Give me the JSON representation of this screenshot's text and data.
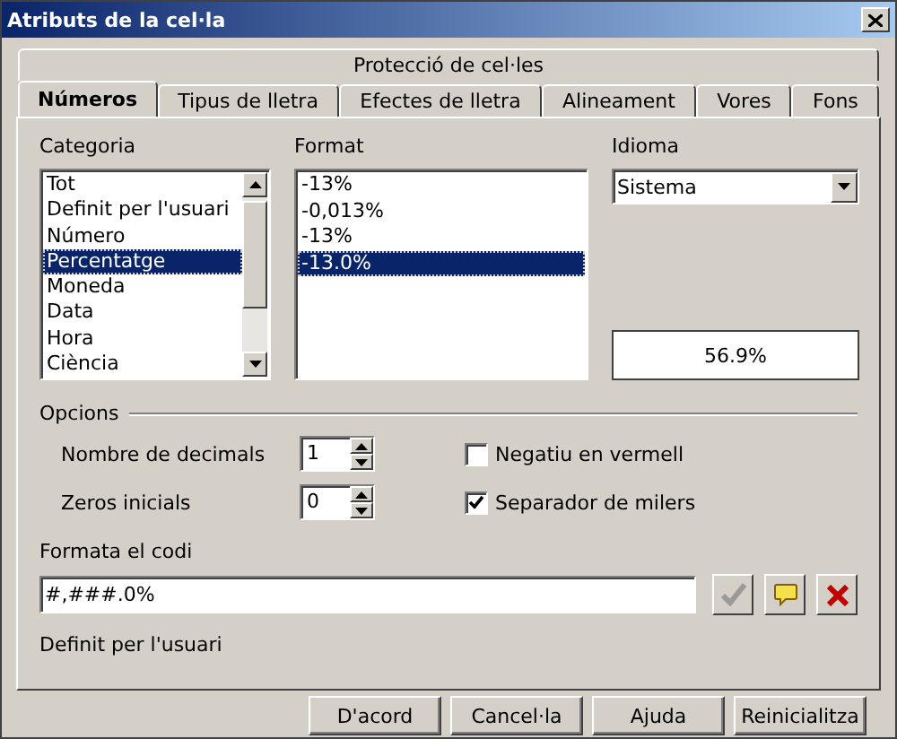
{
  "window": {
    "title": "Atributs de la cel·la"
  },
  "tab_rows": [
    [
      {
        "label": "Protecció de cel·les",
        "selected": false
      }
    ],
    [
      {
        "label": "Números",
        "selected": true
      },
      {
        "label": "Tipus de lletra",
        "selected": false
      },
      {
        "label": "Efectes de lletra",
        "selected": false
      },
      {
        "label": "Alineament",
        "selected": false
      },
      {
        "label": "Vores",
        "selected": false
      },
      {
        "label": "Fons",
        "selected": false
      }
    ]
  ],
  "category": {
    "label": "Categoria",
    "items": [
      {
        "label": "Tot",
        "selected": false
      },
      {
        "label": "Definit per l'usuari",
        "selected": false
      },
      {
        "label": "Número",
        "selected": false
      },
      {
        "label": "Percentatge",
        "selected": true
      },
      {
        "label": "Moneda",
        "selected": false
      },
      {
        "label": "Data",
        "selected": false
      },
      {
        "label": "Hora",
        "selected": false
      },
      {
        "label": "Ciència",
        "selected": false
      }
    ]
  },
  "format": {
    "label": "Format",
    "items": [
      {
        "label": "-13%",
        "selected": false
      },
      {
        "label": "-0,013%",
        "selected": false
      },
      {
        "label": "-13%",
        "selected": false
      },
      {
        "label": "-13.0%",
        "selected": true
      }
    ]
  },
  "language": {
    "label": "Idioma",
    "value": "Sistema"
  },
  "preview": "56.9%",
  "options": {
    "title": "Opcions",
    "spinners": [
      {
        "label": "Nombre de decimals",
        "value": "1"
      },
      {
        "label": "Zeros inicials",
        "value": "0"
      }
    ],
    "checkboxes": [
      {
        "label": "Negatiu en vermell",
        "checked": false
      },
      {
        "label": "Separador de milers",
        "checked": true
      }
    ]
  },
  "format_code": {
    "label": "Formata el codi",
    "value": "#,###.0%"
  },
  "description": "Definit per l'usuari",
  "buttons": [
    "D'acord",
    "Cancel·la",
    "Ajuda",
    "Reinicialitza"
  ]
}
